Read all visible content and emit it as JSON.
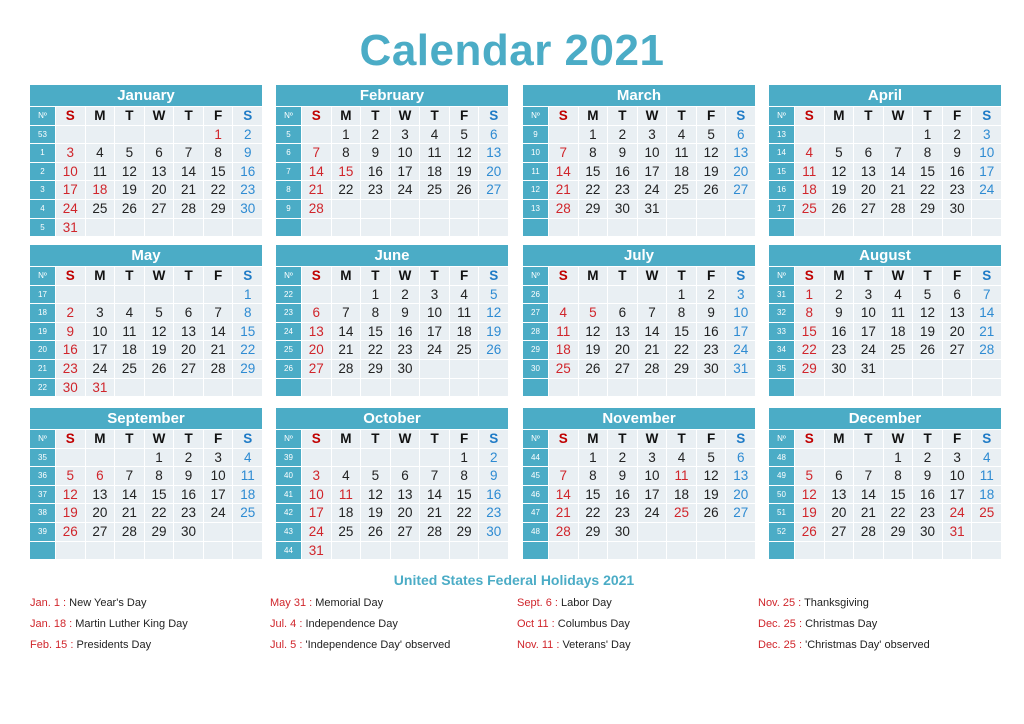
{
  "title": "Calendar 2021",
  "weekday_headers": {
    "week_no": "Nº",
    "days": [
      "S",
      "M",
      "T",
      "W",
      "T",
      "F",
      "S"
    ]
  },
  "months": [
    {
      "name": "January",
      "weeks": [
        "53",
        "1",
        "2",
        "3",
        "4",
        "5"
      ],
      "start": 5,
      "days": 31,
      "highlight": [
        1,
        18
      ]
    },
    {
      "name": "February",
      "weeks": [
        "5",
        "6",
        "7",
        "8",
        "9",
        ""
      ],
      "start": 1,
      "days": 28,
      "highlight": [
        15
      ]
    },
    {
      "name": "March",
      "weeks": [
        "9",
        "10",
        "11",
        "12",
        "13",
        ""
      ],
      "start": 1,
      "days": 31,
      "highlight": []
    },
    {
      "name": "April",
      "weeks": [
        "13",
        "14",
        "15",
        "16",
        "17",
        ""
      ],
      "start": 4,
      "days": 30,
      "highlight": []
    },
    {
      "name": "May",
      "weeks": [
        "17",
        "18",
        "19",
        "20",
        "21",
        "22"
      ],
      "start": 6,
      "days": 31,
      "highlight": [
        31
      ]
    },
    {
      "name": "June",
      "weeks": [
        "22",
        "23",
        "24",
        "25",
        "26",
        ""
      ],
      "start": 2,
      "days": 30,
      "highlight": []
    },
    {
      "name": "July",
      "weeks": [
        "26",
        "27",
        "28",
        "29",
        "30",
        ""
      ],
      "start": 4,
      "days": 31,
      "highlight": [
        5
      ]
    },
    {
      "name": "August",
      "weeks": [
        "31",
        "32",
        "33",
        "34",
        "35",
        ""
      ],
      "start": 0,
      "days": 31,
      "highlight": []
    },
    {
      "name": "September",
      "weeks": [
        "35",
        "36",
        "37",
        "38",
        "39",
        ""
      ],
      "start": 3,
      "days": 30,
      "highlight": [
        6
      ]
    },
    {
      "name": "October",
      "weeks": [
        "39",
        "40",
        "41",
        "42",
        "43",
        "44"
      ],
      "start": 5,
      "days": 31,
      "highlight": [
        11
      ]
    },
    {
      "name": "November",
      "weeks": [
        "44",
        "45",
        "46",
        "47",
        "48",
        ""
      ],
      "start": 1,
      "days": 30,
      "highlight": [
        11,
        25
      ]
    },
    {
      "name": "December",
      "weeks": [
        "48",
        "49",
        "50",
        "51",
        "52",
        ""
      ],
      "start": 3,
      "days": 31,
      "highlight": [
        24,
        25,
        31
      ]
    }
  ],
  "holidays": {
    "title": "United States Federal Holidays 2021",
    "columns": [
      [
        {
          "date": "Jan. 1",
          "name": "New Year's Day"
        },
        {
          "date": "Jan. 18",
          "name": "Martin Luther King Day"
        },
        {
          "date": "Feb. 15",
          "name": "Presidents Day"
        }
      ],
      [
        {
          "date": "May 31",
          "name": "Memorial Day"
        },
        {
          "date": "Jul. 4",
          "name": "Independence Day"
        },
        {
          "date": "Jul. 5",
          "name": "'Independence Day' observed"
        }
      ],
      [
        {
          "date": "Sept. 6",
          "name": "Labor Day"
        },
        {
          "date": "Oct 11",
          "name": "Columbus Day"
        },
        {
          "date": "Nov. 11",
          "name": "Veterans' Day"
        }
      ],
      [
        {
          "date": "Nov. 25",
          "name": "Thanksgiving"
        },
        {
          "date": "Dec. 25",
          "name": "Christmas Day"
        },
        {
          "date": "Dec. 25",
          "name": "'Christmas Day' observed"
        }
      ]
    ]
  },
  "colors": {
    "accent": "#4bacc6",
    "sunday": "#d0252b",
    "saturday": "#2e8bd2",
    "cell_bg": "#e9eff3"
  }
}
